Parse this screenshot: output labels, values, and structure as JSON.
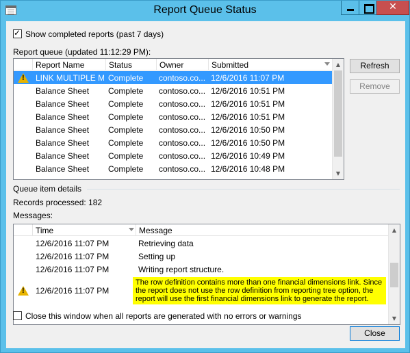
{
  "window": {
    "title": "Report Queue Status",
    "close_glyph": "✕"
  },
  "options": {
    "show_completed_label": "Show completed reports (past 7 days)",
    "show_completed_checked": true
  },
  "queue": {
    "label": "Report queue (updated 11:12:29 PM):",
    "columns": [
      "Report Name",
      "Status",
      "Owner",
      "Submitted"
    ],
    "rows": [
      {
        "icon": "warning-icon",
        "name": "LINK MULTIPLE M...",
        "status": "Complete",
        "owner": "contoso.co...",
        "submitted": "12/6/2016 11:07 PM",
        "selected": true
      },
      {
        "icon": "",
        "name": "Balance Sheet",
        "status": "Complete",
        "owner": "contoso.co...",
        "submitted": "12/6/2016 10:51 PM",
        "selected": false
      },
      {
        "icon": "",
        "name": "Balance Sheet",
        "status": "Complete",
        "owner": "contoso.co...",
        "submitted": "12/6/2016 10:51 PM",
        "selected": false
      },
      {
        "icon": "",
        "name": "Balance Sheet",
        "status": "Complete",
        "owner": "contoso.co...",
        "submitted": "12/6/2016 10:51 PM",
        "selected": false
      },
      {
        "icon": "",
        "name": "Balance Sheet",
        "status": "Complete",
        "owner": "contoso.co...",
        "submitted": "12/6/2016 10:50 PM",
        "selected": false
      },
      {
        "icon": "",
        "name": "Balance Sheet",
        "status": "Complete",
        "owner": "contoso.co...",
        "submitted": "12/6/2016 10:50 PM",
        "selected": false
      },
      {
        "icon": "",
        "name": "Balance Sheet",
        "status": "Complete",
        "owner": "contoso.co...",
        "submitted": "12/6/2016 10:49 PM",
        "selected": false
      },
      {
        "icon": "",
        "name": "Balance Sheet",
        "status": "Complete",
        "owner": "contoso.co...",
        "submitted": "12/6/2016 10:48 PM",
        "selected": false
      }
    ],
    "refresh_label": "Refresh",
    "remove_label": "Remove"
  },
  "details": {
    "section_label": "Queue item details",
    "records_processed": "Records processed:  182",
    "messages_label": "Messages:",
    "columns": [
      "Time",
      "Message"
    ],
    "rows": [
      {
        "icon": "",
        "time": "12/6/2016 11:07 PM",
        "message": "Retrieving data",
        "highlight": false
      },
      {
        "icon": "",
        "time": "12/6/2016 11:07 PM",
        "message": "Setting up",
        "highlight": false
      },
      {
        "icon": "",
        "time": "12/6/2016 11:07 PM",
        "message": "Writing report structure.",
        "highlight": false
      },
      {
        "icon": "warning-icon",
        "time": "12/6/2016 11:07 PM",
        "message": "The row definition contains more than one financial dimensions link.  Since the report does not use the row definition from reporting tree option, the report will use the first financial dimensions link to generate the report.",
        "highlight": true
      }
    ]
  },
  "footer": {
    "close_when_done_label": "Close this window when all reports are generated with no errors or warnings",
    "close_when_done_checked": false,
    "close_label": "Close"
  },
  "colors": {
    "titlebar": "#5bc0ea",
    "selection": "#3399ff",
    "highlight": "#ffff00",
    "warning": "#e8b400"
  }
}
